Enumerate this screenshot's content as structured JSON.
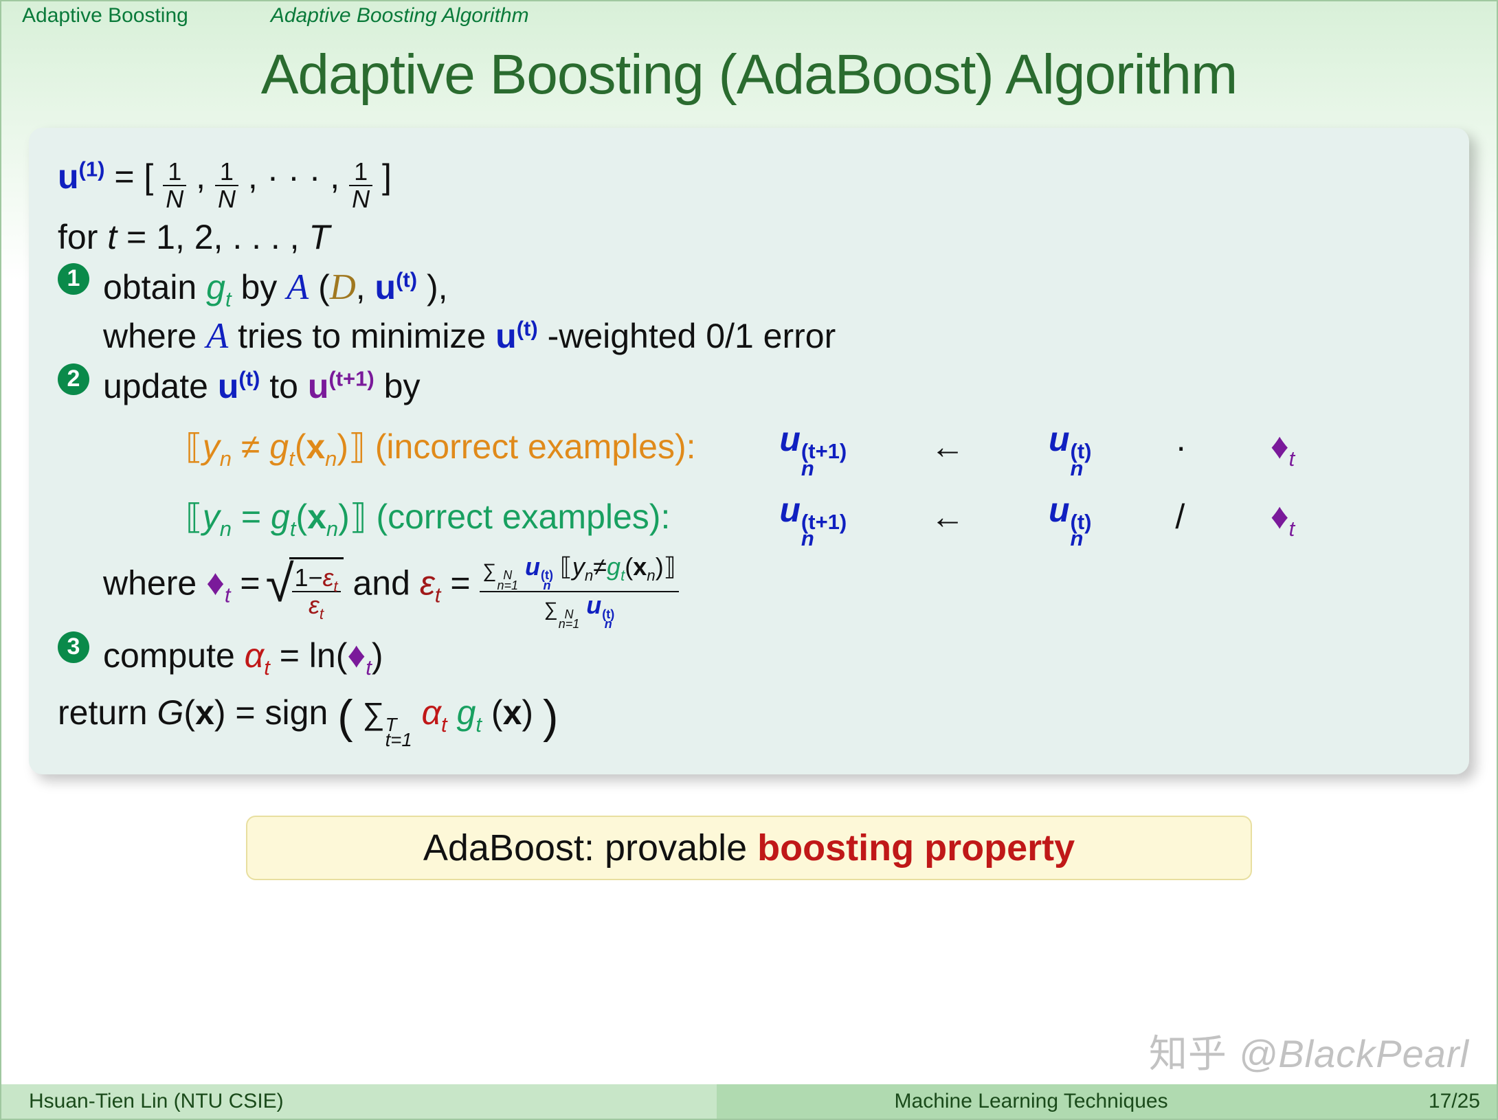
{
  "header": {
    "section": "Adaptive Boosting",
    "subsection": "Adaptive Boosting Algorithm"
  },
  "title": "Adaptive Boosting (AdaBoost) Algorithm",
  "init": {
    "u_label": "u",
    "u_sup": "(1)",
    "eq": " = [",
    "frac_n": "1",
    "frac_d_N": "N",
    "sep": ", ",
    "dots": "· · · ",
    "close": "]"
  },
  "forline": {
    "for": "for ",
    "t": "t",
    "rest": " = 1, 2, . . . , ",
    "T": "T"
  },
  "steps": {
    "s1": {
      "num": "1",
      "l1_a": "obtain ",
      "l1_g": "g",
      "l1_gt_sub": "t",
      "l1_b": " by ",
      "l1_A": "A",
      "l1_op": "(",
      "l1_D": "D",
      "l1_c": ", ",
      "l1_u": "u",
      "l1_usup": "(t)",
      "l1_cp": "),",
      "l2_a": "where ",
      "l2_A": "A",
      "l2_b": " tries to minimize ",
      "l2_u": "u",
      "l2_usup": "(t)",
      "l2_c": "-weighted 0/1 error"
    },
    "s2": {
      "num": "2",
      "l1_a": "update ",
      "l1_u": "u",
      "l1_usup": "(t)",
      "l1_b": " to ",
      "l1_u2": "u",
      "l1_u2sup": "(t+1)",
      "l1_c": " by",
      "row_inc_cond": "⟦yₙ ≠ gₜ(xₙ)⟧",
      "row_inc_label": " (incorrect examples):",
      "row_cor_cond": "⟦yₙ = gₜ(xₙ)⟧",
      "row_cor_label": " (correct examples):",
      "u_lhs_base": "u",
      "u_lhs_sup": "(t+1)",
      "u_lhs_sub": "n",
      "arrow": "←",
      "u_rhs_base": "u",
      "u_rhs_sup": "(t)",
      "u_rhs_sub": "n",
      "op_mul": "·",
      "op_div": "/",
      "dia": "♦",
      "dia_sub": "t",
      "where_a": "where ",
      "where_dia": "♦",
      "where_dia_sub": "t",
      "where_eq": " = ",
      "sqrt_num_a": "1−",
      "sqrt_num_eps": "ε",
      "sqrt_num_sub": "t",
      "sqrt_den_eps": "ε",
      "sqrt_den_sub": "t",
      "and": " and ",
      "eps": "ε",
      "eps_sub": "t",
      "eq2": " = ",
      "bigfrac_num": "∑ₙ₌₁ᴺ uₙ(t) ⟦yₙ≠gₜ(xₙ)⟧",
      "bigfrac_den": "∑ₙ₌₁ᴺ uₙ(t)"
    },
    "s3": {
      "num": "3",
      "a": "compute ",
      "alpha": "α",
      "alpha_sub": "t",
      "eq": " = ln(",
      "dia": "♦",
      "dia_sub": "t",
      "cp": ")"
    }
  },
  "return": {
    "a": "return ",
    "G": "G",
    "op": "(",
    "x": "x",
    "cp": ") = sign ",
    "lpar": "(",
    "sum": "∑",
    "sum_top": "T",
    "sum_bot": "t=1",
    "sp": " ",
    "alpha": "α",
    "alpha_sub": "t",
    "g": "g",
    "g_sub": "t",
    "op2": "(",
    "x2": "x",
    "cp2": ")",
    "rpar": ")"
  },
  "highlight": {
    "a": "AdaBoost: provable ",
    "b": "boosting property"
  },
  "watermark": {
    "zh": "知乎",
    "handle": " @BlackPearl"
  },
  "footer": {
    "left": "Hsuan-Tien Lin  (NTU CSIE)",
    "mid": "Machine Learning Techniques",
    "right": "17/25"
  }
}
